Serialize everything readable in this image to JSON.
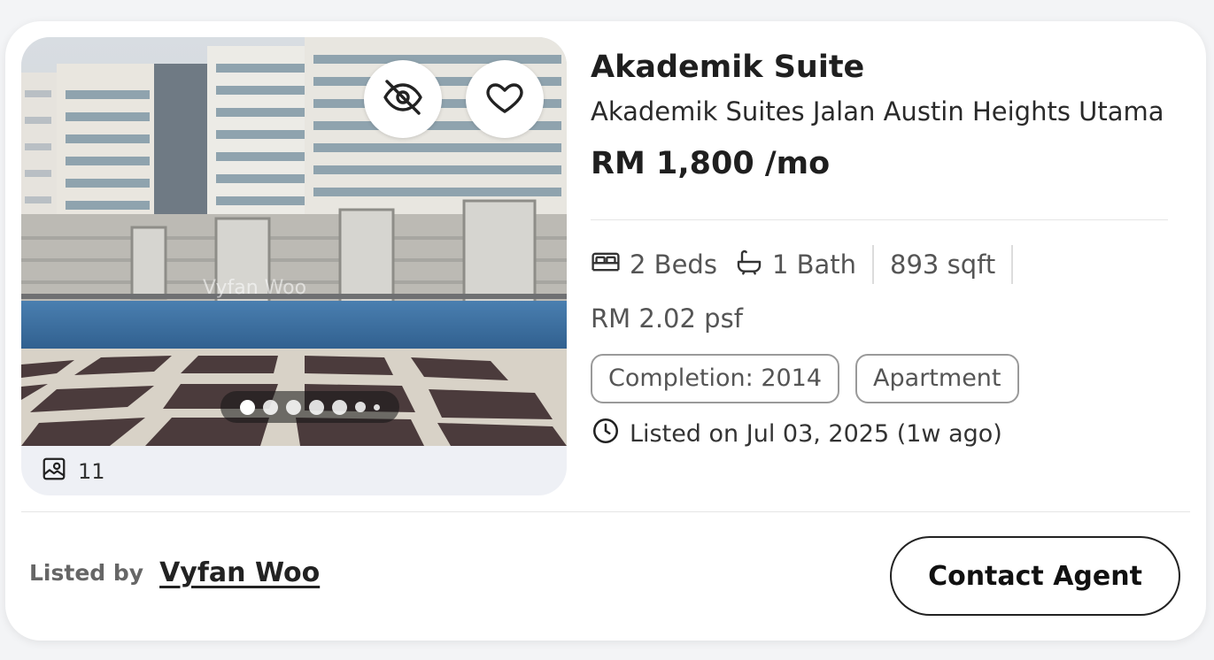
{
  "listing": {
    "title": "Akademik Suite",
    "address": "Akademik Suites Jalan Austin Heights Utama",
    "price": "RM 1,800 /mo",
    "beds": "2 Beds",
    "baths": "1 Bath",
    "size": "893 sqft",
    "psf": "RM 2.02 psf",
    "tags": [
      "Completion: 2014",
      "Apartment"
    ],
    "listed_on": "Listed on Jul 03, 2025 (1w ago)"
  },
  "photo": {
    "count": "11",
    "watermark": "Vyfan Woo",
    "carousel_total_dots": 7,
    "carousel_active_index": 0
  },
  "footer": {
    "listed_by_label": "Listed by",
    "agent_name": "Vyfan Woo",
    "contact_label": "Contact Agent"
  },
  "icons": {
    "hide": "eye-off-icon",
    "favorite": "heart-icon",
    "photos": "image-icon",
    "bed": "bed-icon",
    "bath": "bathtub-icon",
    "clock": "clock-icon"
  },
  "colors": {
    "card_bg": "#ffffff",
    "page_bg": "#f3f4f6",
    "text_primary": "#1f1f1f",
    "text_muted": "#555555",
    "border": "#9a9a9a"
  }
}
